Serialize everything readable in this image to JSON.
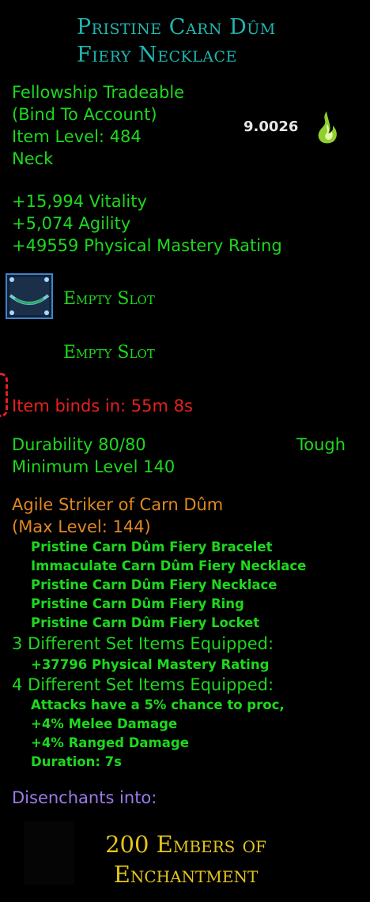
{
  "item": {
    "title_line1": "Pristine Carn Dûm",
    "title_line2": "Fiery Necklace",
    "tradeable": "Fellowship Tradeable",
    "bind": "(Bind To Account)",
    "item_level": "Item Level: 484",
    "slot_type": "Neck",
    "score": "9.0026"
  },
  "stats": [
    "+15,994 Vitality",
    "+5,074 Agility",
    "+49559 Physical Mastery Rating"
  ],
  "essence_slots": [
    "Empty Slot",
    "Empty Slot"
  ],
  "bind_timer": "Item binds in: 55m 8s",
  "durability": {
    "label": "Durability 80/80",
    "tier": "Tough",
    "min_level": "Minimum Level 140"
  },
  "set": {
    "name": "Agile Striker of Carn Dûm",
    "max_level": "(Max Level: 144)",
    "items": [
      "Pristine Carn Dûm Fiery Bracelet",
      "Immaculate Carn Dûm Fiery Necklace",
      "Pristine Carn Dûm Fiery Necklace",
      "Pristine Carn Dûm Fiery Ring",
      "Pristine Carn Dûm Fiery Locket"
    ],
    "bonus3_header": "3 Different Set Items Equipped:",
    "bonus3": [
      "+37796 Physical Mastery Rating"
    ],
    "bonus4_header": "4 Different Set Items Equipped:",
    "bonus4": [
      "Attacks have a 5% chance to proc,",
      "+4% Melee Damage",
      "+4% Ranged Damage",
      "Duration: 7s"
    ]
  },
  "disenchant": {
    "label": "Disenchants into:",
    "result_line1": "200 Embers of",
    "result_line2": "Enchantment"
  },
  "colors": {
    "title": "#1fb6b0",
    "stat_green": "#1ed81e",
    "bind_red": "#e8201c",
    "set_orange": "#e08822",
    "disenchant_purple": "#9a7bea",
    "reward_gold": "#e2c41c"
  },
  "icons": [
    "flame-icon",
    "essence-slot-icon"
  ]
}
